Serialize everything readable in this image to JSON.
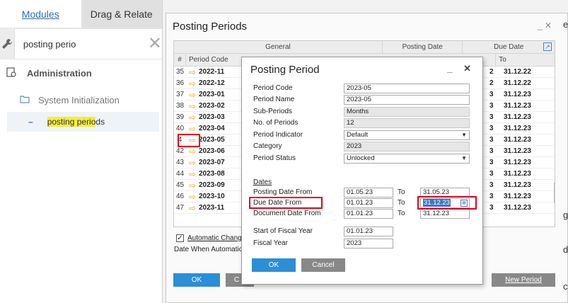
{
  "left": {
    "tabs": [
      "Modules",
      "Drag & Relate"
    ],
    "search_value": "posting perio",
    "tree": {
      "admin": "Administration",
      "system": "System Initialization",
      "item_highlight": "posting perio",
      "item_rest": "ds"
    }
  },
  "pp": {
    "title": "Posting Periods",
    "controls": "_   ✕",
    "group_headers": [
      "General",
      "Posting Date",
      "Due Date"
    ],
    "col_headers": [
      "#",
      "Period Code",
      "To"
    ],
    "rows": [
      {
        "num": "35",
        "code": "2022-11",
        "c1": "2",
        "c2": "31.12.22"
      },
      {
        "num": "36",
        "code": "2022-12",
        "c1": "2",
        "c2": "31.12.22"
      },
      {
        "num": "37",
        "code": "2023-01",
        "c1": "3",
        "c2": "31.12.23"
      },
      {
        "num": "38",
        "code": "2023-02",
        "c1": "3",
        "c2": "31.12.23"
      },
      {
        "num": "39",
        "code": "2023-03",
        "c1": "3",
        "c2": "31.12.23"
      },
      {
        "num": "40",
        "code": "2023-04",
        "c1": "3",
        "c2": "31.12.23"
      },
      {
        "num": "4",
        "code": "2023-05",
        "c1": "3",
        "c2": "31.12.23"
      },
      {
        "num": "42",
        "code": "2023-06",
        "c1": "3",
        "c2": "31.12.23"
      },
      {
        "num": "43",
        "code": "2023-07",
        "c1": "3",
        "c2": "31.12.23"
      },
      {
        "num": "44",
        "code": "2023-08",
        "c1": "3",
        "c2": "31.12.23"
      },
      {
        "num": "45",
        "code": "2023-09",
        "c1": "3",
        "c2": "31.12.23"
      },
      {
        "num": "46",
        "code": "2023-10",
        "c1": "3",
        "c2": "31.12.23"
      },
      {
        "num": "47",
        "code": "2023-11",
        "c1": "3",
        "c2": "31.12.23"
      }
    ],
    "auto_label": "Automatic Chang",
    "date_when": "Date When Automatic",
    "ok": "OK",
    "c_btn": "C",
    "new_period": "New Period",
    "edge_chars": [
      "e",
      "g",
      "d",
      "c"
    ]
  },
  "dialog": {
    "title": "Posting Period",
    "controls": "_ ✕",
    "fields": [
      {
        "label": "Period Code",
        "value": "2023-05"
      },
      {
        "label": "Period Name",
        "value": "2023-05"
      },
      {
        "label": "Sub-Periods",
        "value": "Months"
      },
      {
        "label": "No. of Periods",
        "value": "12"
      },
      {
        "label": "Period Indicator",
        "value": "Default"
      },
      {
        "label": "Category",
        "value": "2023"
      },
      {
        "label": "Period Status",
        "value": "Unlocked"
      }
    ],
    "dates_header": "Dates",
    "date_rows": [
      {
        "label": "Posting Date From",
        "from": "01.05.23",
        "to_label": "To",
        "to": "31.05.23"
      },
      {
        "label": "Due Date From",
        "from": "01.01.23",
        "to_label": "To",
        "to": "31.12.23"
      },
      {
        "label": "Document Date From",
        "from": "01.01.23",
        "to_label": "To",
        "to": "31.12.23"
      }
    ],
    "fiscal_start_label": "Start of Fiscal Year",
    "fiscal_start": "01.01.23",
    "fiscal_year_label": "Fiscal Year",
    "fiscal_year": "2023",
    "ok": "OK",
    "cancel": "Cancel"
  },
  "colors": {
    "accent": "#2a8fd6",
    "highlight": "#f6ee37",
    "annotation": "#e3001b",
    "arrow": "#e7a21b"
  }
}
